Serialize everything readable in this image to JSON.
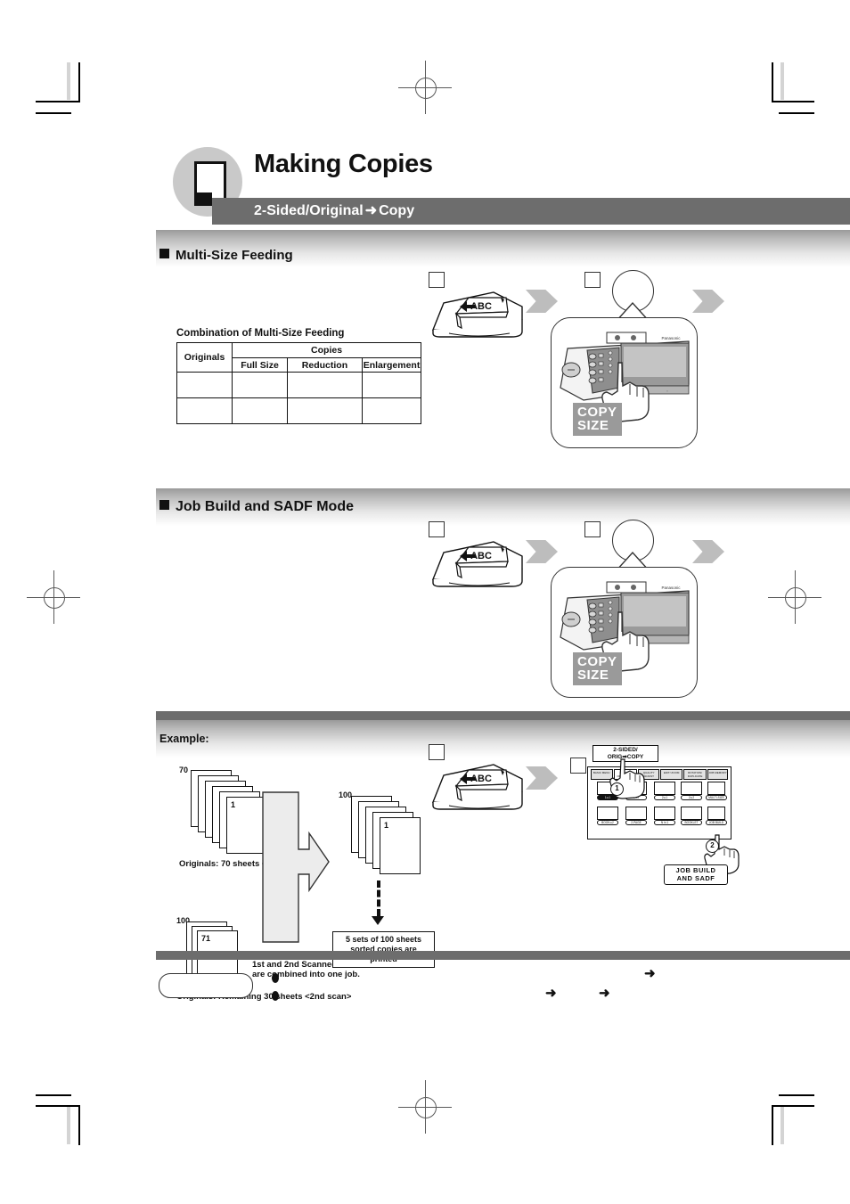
{
  "document": {
    "title": "Making Copies",
    "subtitle_left": "2-Sided/Original",
    "subtitle_arrow": "➜",
    "subtitle_right": "Copy",
    "badge_icon": "document-page-icon"
  },
  "sections": [
    {
      "id": "multi-size",
      "heading": "Multi-Size Feeding"
    },
    {
      "id": "job-build",
      "heading": "Job Build and SADF Mode"
    },
    {
      "id": "example",
      "heading": "Example:"
    }
  ],
  "combination_table": {
    "caption": "Combination of Multi-Size Feeding",
    "row_header": "Originals",
    "group_header": "Copies",
    "columns": [
      "Full Size",
      "Reduction",
      "Enlargement"
    ],
    "rows": [
      {
        "label": "",
        "cells": [
          "",
          "",
          ""
        ]
      },
      {
        "label": "",
        "cells": [
          "",
          "",
          ""
        ]
      }
    ]
  },
  "illustrations": {
    "adf_document_text": "ABC",
    "copy_size_label_line1": "COPY",
    "copy_size_label_line2": "SIZE",
    "brand": "Panasonic",
    "step_markers": [
      "",
      "",
      "",
      ""
    ]
  },
  "example": {
    "stack1_count": "70",
    "stack1_first": "1",
    "stack1_caption": "Originals: 70 sheets <1st scan>",
    "stack2_count": "100",
    "stack2_first": "71",
    "stack2_caption": "Originals: Remaining 30 sheets <2nd scan>",
    "stack3_count": "100",
    "stack3_first": "1",
    "merge_note_line1": "1st and 2nd Scanned Data",
    "merge_note_line2": "are combined into one job.",
    "output_note_line1": "5 sets of 100 sheets",
    "output_note_line2": "sorted copies are printed"
  },
  "lcd_panel": {
    "mode_flag_line1": "2-SIDED/",
    "mode_flag_line2": "ORIG➡COPY",
    "tabs": [
      "BASIC MENU",
      "2-SIDED/\nORIG➡COPY",
      "QUALITY\nADJUST",
      "EDIT/\nZOOM",
      "ROTATION/\nDUPLICATE",
      "JOB\nMEMORY"
    ],
    "active_tab_index": 1,
    "key_labels_row1": [
      "1➡1",
      "1➡2",
      "2➡1",
      "2➡2",
      "MULTI-SIZE"
    ],
    "key_labels_row2": [
      "BOOK➡2",
      "2-PAGE",
      "N in 1",
      "BOOKLET",
      "JOB BUILD"
    ],
    "active_key_index": 0,
    "job_build_button_line1": "JOB BUILD",
    "job_build_button_line2": "AND SADF",
    "callout_number_1": "1",
    "callout_number_2": "2"
  },
  "colors": {
    "title_bar": "#6d6d6d",
    "divider": "#6d6d6d",
    "badge": "#c9c9c9",
    "chevron": "#bdbdbd",
    "copy_size_bg": "#9a9a9a",
    "ink": "#111111"
  },
  "footer": {
    "note_pill_label": "",
    "bullets": [
      "",
      ""
    ],
    "arrows": [
      "➜",
      "➜",
      "➜"
    ]
  }
}
